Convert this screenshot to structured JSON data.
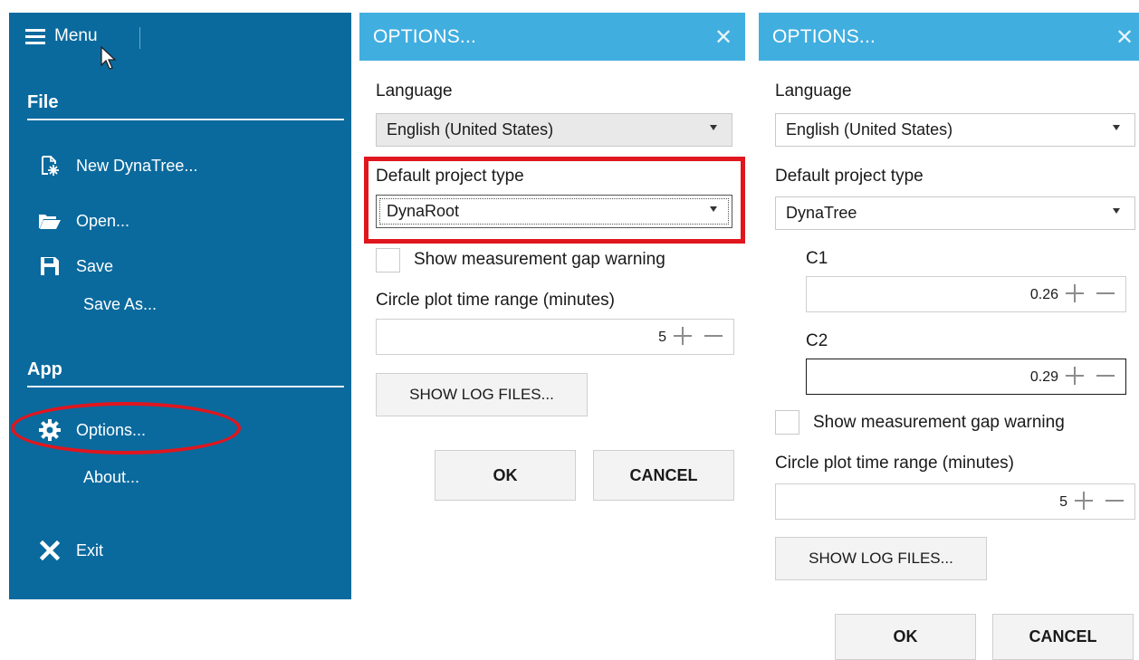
{
  "menu": {
    "title": "Menu",
    "file_section": "File",
    "file_items": [
      "New DynaTree...",
      "Open...",
      "Save",
      "Save As..."
    ],
    "app_section": "App",
    "app_items": [
      "Options...",
      "About..."
    ],
    "exit_label": "Exit",
    "highlighted_item": "Options..."
  },
  "dialog_left": {
    "title": "OPTIONS...",
    "language_label": "Language",
    "language_value": "English (United States)",
    "project_type_label": "Default project type",
    "project_type_value": "DynaRoot",
    "gap_warning_label": "Show measurement gap warning",
    "time_range_label": "Circle plot time range (minutes)",
    "time_range_value": "5",
    "log_button": "SHOW LOG FILES...",
    "ok_button": "OK",
    "cancel_button": "CANCEL"
  },
  "dialog_right": {
    "title": "OPTIONS...",
    "language_label": "Language",
    "language_value": "English (United States)",
    "project_type_label": "Default project type",
    "project_type_value": "DynaTree",
    "c1_label": "C1",
    "c1_value": "0.26",
    "c2_label": "C2",
    "c2_value": "0.29",
    "gap_warning_label": "Show measurement gap warning",
    "time_range_label": "Circle plot time range (minutes)",
    "time_range_value": "5",
    "log_button": "SHOW LOG FILES...",
    "ok_button": "OK",
    "cancel_button": "CANCEL"
  },
  "colors": {
    "menu_bg": "#0a6a9e",
    "dialog_header": "#41aee0",
    "highlight_red": "#e0161e"
  }
}
